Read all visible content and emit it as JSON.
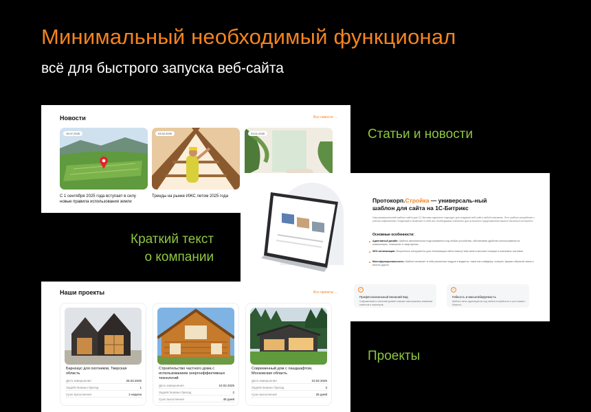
{
  "headline": "Минимальный необходимый функционал",
  "subheadline": "всё для быстрого запуска веб-сайта",
  "callouts": {
    "news": "Статьи и новости",
    "about_line1": "Краткий текст",
    "about_line2": "о компании",
    "projects": "Проекты"
  },
  "news": {
    "title": "Новости",
    "all_link": "Все новости →",
    "items": [
      {
        "date": "15.07.2025",
        "text": "С 1 сентября 2025 года вступает в силу новые правила использования земли"
      },
      {
        "date": "03.02.2025",
        "text": "Тренды на рынке ИЖС летом 2025 года"
      },
      {
        "date": "23.01.2025",
        "text": ""
      }
    ]
  },
  "about": {
    "title_prefix": "Протокорп.",
    "title_accent": "Стройка",
    "title_suffix": " — универсаль-ный шаблон для сайта на 1С-Битрикс",
    "desc": "Наш универсальный шаблон сайта для 1С-Битрикс идеально подходит для создания веб-сайта любой компании. Этот шаблон разработан с учетом современных тенденций и включает в себя все необходимые элементы для успешного представления вашего бизнеса в интернете.",
    "features_title": "Основные особенности:",
    "features": [
      {
        "name": "Адаптивный дизайн:",
        "text": " Шаблон автоматически подстраивается под любые устройства, обеспечивая удобство использования на компьютерах, планшетах и смартфонах."
      },
      {
        "name": "SEO-оптимизация:",
        "text": " Встроенные инструменты для оптимизации сайта помогут вам занять высокие позиции в поисковых системах."
      },
      {
        "name": "Многофункциональность:",
        "text": " Шаблон включает в себя различные модули и виджеты, такие как слайдеры, галереи, формы обратной связи и многое другое."
      }
    ],
    "boxes": [
      {
        "title": "Профессиональный внешний вид",
        "text": "Современный и стильный дизайн поможет вам привлечь внимание клиентов и партнеров."
      },
      {
        "title": "Гибкость и масштабируемость",
        "text": "Шаблон легко адаптируется под любые потребности и рост вашего бизнеса."
      }
    ]
  },
  "projects": {
    "title": "Наши проекты",
    "all_link": "Все проекты →",
    "items": [
      {
        "name": "Барнхаус для охотников, Тверская область",
        "rows": [
          {
            "label": "Дата завершения",
            "value": "25.03.2025"
          },
          {
            "label": "Задействовано бригад",
            "value": "1"
          },
          {
            "label": "Срок выполнения",
            "value": "4 недели"
          }
        ]
      },
      {
        "name": "Строительство частного дома с использованием энергоэффективных технологий",
        "rows": [
          {
            "label": "Дата завершения",
            "value": "10.02.2025"
          },
          {
            "label": "Задействовано бригад",
            "value": "2"
          },
          {
            "label": "Срок выполнения",
            "value": "45 дней"
          }
        ]
      },
      {
        "name": "Современный дом с ландшафтом, Московская область",
        "rows": [
          {
            "label": "Дата завершения",
            "value": "10.02.2025"
          },
          {
            "label": "Задействовано бригад",
            "value": "3"
          },
          {
            "label": "Срок выполнения",
            "value": "25 дней"
          }
        ]
      }
    ]
  },
  "colors": {
    "accent": "#f5841f",
    "callout": "#8ec641",
    "background": "#000000"
  }
}
